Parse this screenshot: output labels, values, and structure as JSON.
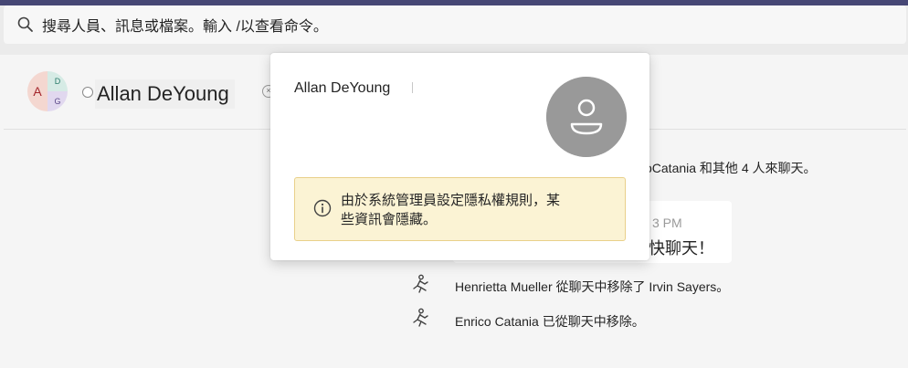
{
  "search": {
    "placeholder": "搜尋人員、訊息或檔案。輸入 /以查看命令。"
  },
  "header": {
    "title": "Allan DeYoung",
    "group_avatar": {
      "initial_main": "A",
      "initial_top": "D",
      "initial_bottom": "G"
    }
  },
  "profile_card": {
    "name": "Allan DeYoung",
    "privacy_notice": "由於系統管理員設定隱私權規則，某些資訊會隱藏。"
  },
  "messages": {
    "partial_system_text": "：oCatania 和其他 4 人來聊天。",
    "bubble_time": "3 PM",
    "bubble_text": "快聊天！",
    "event_1": "Henrietta  Mueller 從聊天中移除了 Irvin Sayers。",
    "event_2": "Enrico Catania 已從聊天中移除。"
  },
  "colors": {
    "top_accent": "#464775",
    "privacy_background": "#fbf3d4",
    "privacy_border": "#e9d08a",
    "avatar_gray": "#999999"
  },
  "icons": {
    "search": "search-icon",
    "info": "info-icon",
    "person": "person-icon",
    "member_left": "person-walking-icon"
  }
}
